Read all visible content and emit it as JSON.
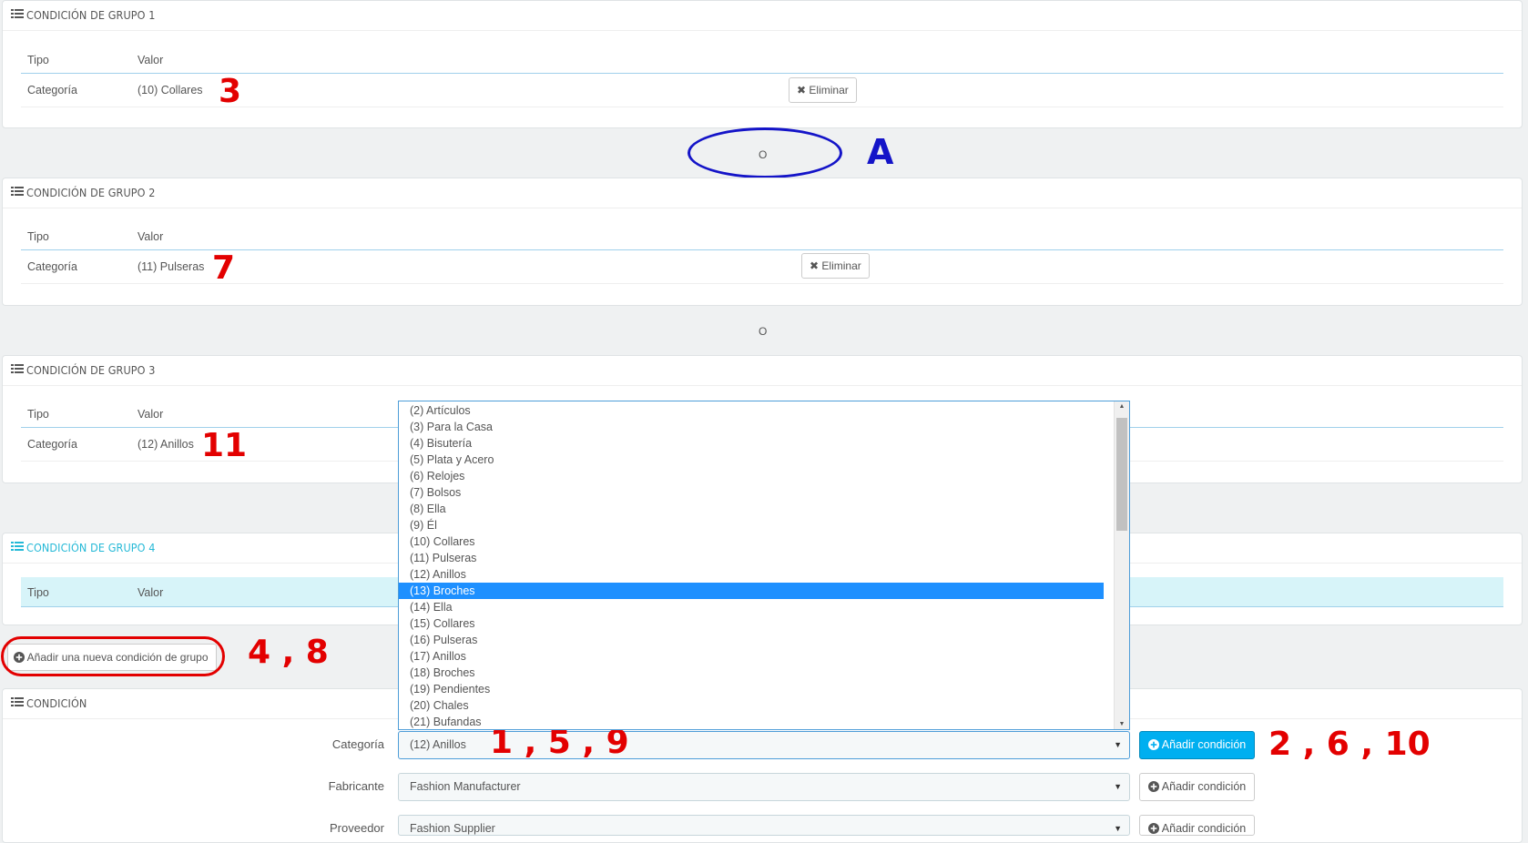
{
  "groups": [
    {
      "title": "CONDICIÓN DE GRUPO 1",
      "col_type": "Tipo",
      "col_value": "Valor",
      "row": {
        "type": "Categoría",
        "value": "(10) Collares"
      },
      "delete_label": "Eliminar"
    },
    {
      "title": "CONDICIÓN DE GRUPO 2",
      "col_type": "Tipo",
      "col_value": "Valor",
      "row": {
        "type": "Categoría",
        "value": "(11) Pulseras"
      },
      "delete_label": "Eliminar"
    },
    {
      "title": "CONDICIÓN DE GRUPO 3",
      "col_type": "Tipo",
      "col_value": "Valor",
      "row": {
        "type": "Categoría",
        "value": "(12) Anillos"
      }
    },
    {
      "title": "CONDICIÓN DE GRUPO 4",
      "col_type": "Tipo",
      "col_value": "Valor"
    }
  ],
  "or_separator": "O",
  "add_group_label": "Añadir una nueva condición de grupo",
  "condition": {
    "title": "CONDICIÓN",
    "fields": [
      {
        "label": "Categoría",
        "value": "(12) Anillos",
        "button": "Añadir condición"
      },
      {
        "label": "Fabricante",
        "value": "Fashion Manufacturer",
        "button": "Añadir condición"
      },
      {
        "label": "Proveedor",
        "value": "Fashion Supplier",
        "button": "Añadir condición"
      }
    ]
  },
  "dropdown": {
    "options": [
      "(2) Artículos",
      "(3) Para la Casa",
      "(4) Bisutería",
      "(5) Plata y Acero",
      "(6) Relojes",
      "(7) Bolsos",
      "(8) Ella",
      "(9) Él",
      "(10) Collares",
      "(11) Pulseras",
      "(12) Anillos",
      "(13) Broches",
      "(14) Ella",
      "(15) Collares",
      "(16) Pulseras",
      "(17) Anillos",
      "(18) Broches",
      "(19) Pendientes",
      "(20) Chales",
      "(21) Bufandas"
    ],
    "highlighted": "(13) Broches"
  },
  "annotations": {
    "a1": "3",
    "a2": "A",
    "a3": "7",
    "a4": "11",
    "a5": "4 , 8",
    "a6": "1 , 5 , 9",
    "a7": "2 , 6 , 10"
  },
  "colors": {
    "accent": "#25b9d7",
    "primary_button": "#00aff0",
    "annotation_red": "#e30000",
    "annotation_blue": "#1414c8",
    "selection": "#1e90ff"
  }
}
